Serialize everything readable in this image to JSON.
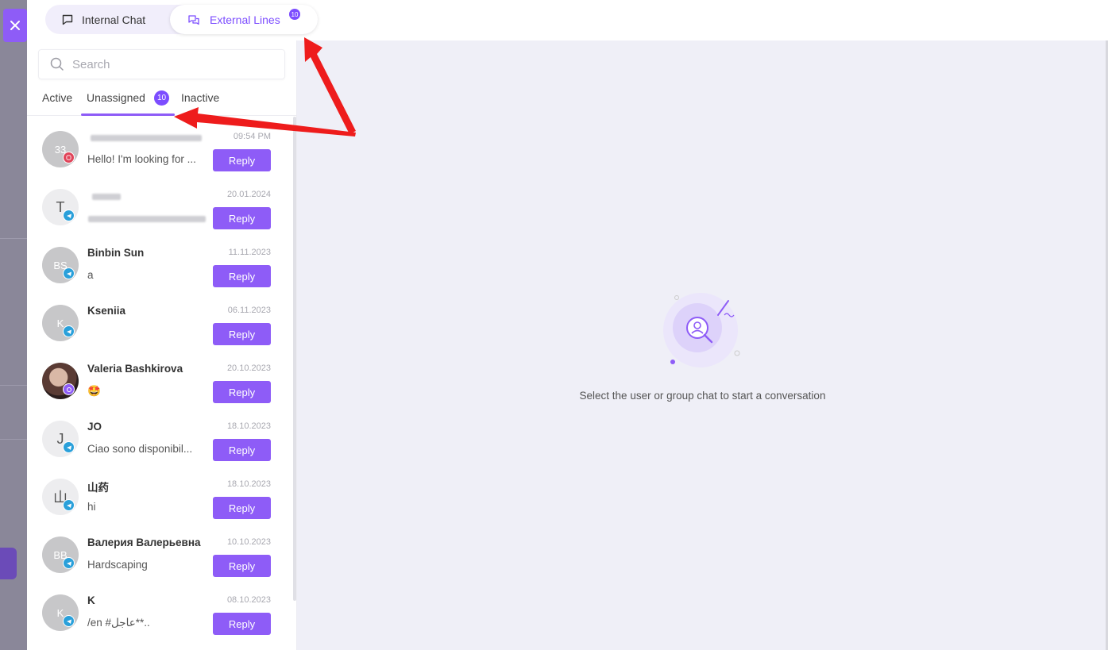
{
  "topbar": {
    "tabs": [
      {
        "label": "Internal Chat",
        "icon": "chat-bubble-icon",
        "active": false
      },
      {
        "label": "External Lines",
        "icon": "multi-chat-icon",
        "active": true,
        "badge": "10"
      }
    ]
  },
  "sidebar": {
    "search_placeholder": "Search",
    "subtabs": [
      {
        "label": "Active"
      },
      {
        "label": "Unassigned",
        "badge": "10",
        "active": true
      },
      {
        "label": "Inactive"
      }
    ],
    "reply_label": "Reply",
    "conversations": [
      {
        "avatar": "33",
        "name": "",
        "preview": "Hello! I'm looking for ...",
        "date": "09:54 PM",
        "platform": "instagram"
      },
      {
        "avatar": "T",
        "name": "",
        "preview": "",
        "date": "20.01.2024",
        "platform": "telegram"
      },
      {
        "avatar": "BS",
        "name": "Binbin Sun",
        "preview": "a",
        "date": "11.11.2023",
        "platform": "telegram"
      },
      {
        "avatar": "K",
        "name": "Kseniia",
        "preview": "",
        "date": "06.11.2023",
        "platform": "telegram"
      },
      {
        "avatar": "",
        "name": "Valeria Bashkirova",
        "preview": "🤩",
        "date": "20.10.2023",
        "platform": "viber"
      },
      {
        "avatar": "J",
        "name": "JO",
        "preview": "Ciao sono disponibil...",
        "date": "18.10.2023",
        "platform": "telegram"
      },
      {
        "avatar": "山",
        "name": "山药",
        "preview": "hi",
        "date": "18.10.2023",
        "platform": "telegram"
      },
      {
        "avatar": "BB",
        "name": "Валерия Валерьевна",
        "preview": "Hardscaping",
        "date": "10.10.2023",
        "platform": "telegram"
      },
      {
        "avatar": "K",
        "name": "K",
        "preview": "/en #عاجل**..",
        "date": "08.10.2023",
        "platform": "telegram"
      }
    ]
  },
  "main": {
    "empty_message": "Select the user or group chat to start a conversation"
  },
  "colors": {
    "accent": "#8e5cf7",
    "badge": "#7c4dff",
    "telegram": "#2aa0da",
    "instagram": "#e0455a",
    "annotation_arrow": "#ee1c1c"
  }
}
